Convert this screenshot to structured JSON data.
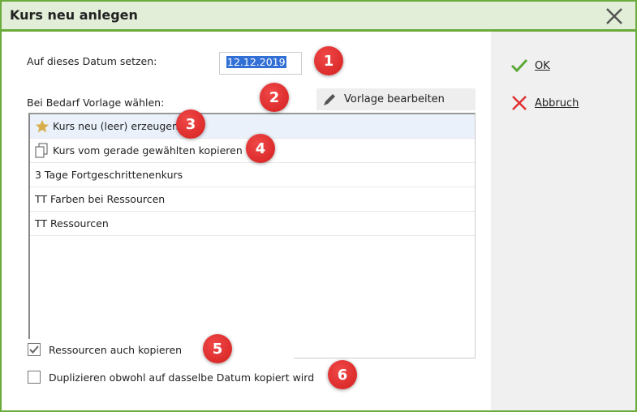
{
  "title": "Kurs neu anlegen",
  "date_label": "Auf dieses Datum setzen:",
  "date_value": "12.12.2019",
  "template_label": "Bei Bedarf Vorlage wählen:",
  "edit_template": "Vorlage bearbeiten",
  "list": [
    {
      "label": "Kurs neu (leer) erzeugen",
      "icon": "star-icon",
      "selected": true
    },
    {
      "label": "Kurs vom gerade gewählten kopieren",
      "icon": "copy-icon"
    },
    {
      "label": "3 Tage Fortgeschrittenenkurs"
    },
    {
      "label": "TT Farben bei Ressourcen"
    },
    {
      "label": "TT Ressourcen"
    }
  ],
  "checkboxes": [
    {
      "label": "Ressourcen auch kopieren",
      "checked": true
    },
    {
      "label": "Duplizieren obwohl auf dasselbe Datum kopiert wird",
      "checked": false
    }
  ],
  "ok_label": "OK",
  "cancel_label": "Abbruch",
  "badges": [
    "1",
    "2",
    "3",
    "4",
    "5",
    "6"
  ],
  "colors": {
    "accent": "#6aab3c",
    "badge": "#d9262b",
    "selection": "#3370d6"
  }
}
